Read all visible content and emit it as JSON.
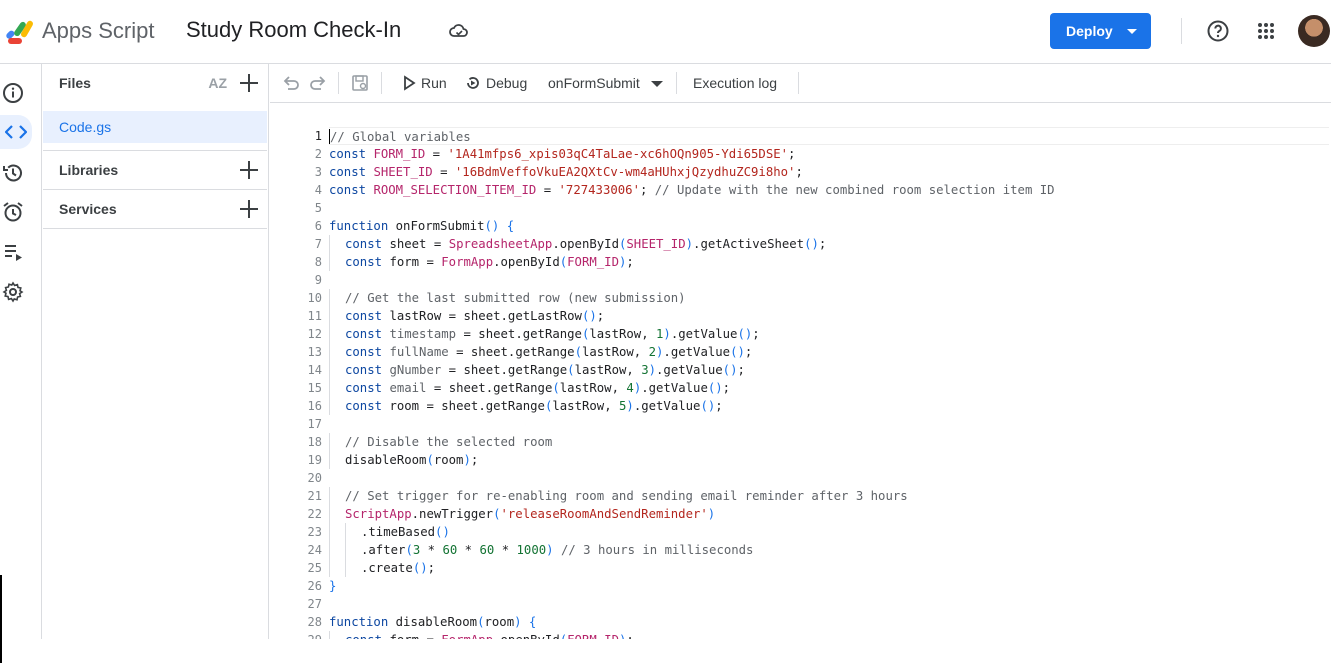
{
  "header": {
    "app_name": "Apps Script",
    "project_title": "Study Room Check-In",
    "deploy_label": "Deploy",
    "icons": [
      "apps-script-logo",
      "cloud-saved-icon",
      "help-icon",
      "apps-grid-icon",
      "avatar"
    ]
  },
  "rail": {
    "icons": [
      "overview-info-icon",
      "editor-code-icon",
      "executions-history-icon",
      "triggers-alarm-icon",
      "executions-list-icon",
      "settings-gear-icon"
    ],
    "active": "editor-code-icon"
  },
  "files_panel": {
    "files_label": "Files",
    "sort_label": "AZ",
    "files": [
      "Code.gs"
    ],
    "libraries_label": "Libraries",
    "services_label": "Services"
  },
  "toolbar": {
    "run_label": "Run",
    "debug_label": "Debug",
    "function_select": "onFormSubmit",
    "execution_log_label": "Execution log"
  },
  "editor": {
    "current_line": 1,
    "lines": [
      {
        "n": "1",
        "text": "// Global variables"
      },
      {
        "n": "2",
        "text": "const FORM_ID = '1A41mfps6_xpis03qC4TaLae-xc6hOQn905-Ydi65DSE';"
      },
      {
        "n": "3",
        "text": "const SHEET_ID = '16BdmVeffoVkuEA2QXtCv-wm4aHUhxjQzydhuZC9i8ho';"
      },
      {
        "n": "4",
        "text": "const ROOM_SELECTION_ITEM_ID = '727433006'; // Update with the new combined room selection item ID"
      },
      {
        "n": "5",
        "text": ""
      },
      {
        "n": "6",
        "text": "function onFormSubmit() {"
      },
      {
        "n": "7",
        "text": "  const sheet = SpreadsheetApp.openById(SHEET_ID).getActiveSheet();"
      },
      {
        "n": "8",
        "text": "  const form = FormApp.openById(FORM_ID);"
      },
      {
        "n": "9",
        "text": ""
      },
      {
        "n": "10",
        "text": "  // Get the last submitted row (new submission)"
      },
      {
        "n": "11",
        "text": "  const lastRow = sheet.getLastRow();"
      },
      {
        "n": "12",
        "text": "  const timestamp = sheet.getRange(lastRow, 1).getValue();"
      },
      {
        "n": "13",
        "text": "  const fullName = sheet.getRange(lastRow, 2).getValue();"
      },
      {
        "n": "14",
        "text": "  const gNumber = sheet.getRange(lastRow, 3).getValue();"
      },
      {
        "n": "15",
        "text": "  const email = sheet.getRange(lastRow, 4).getValue();"
      },
      {
        "n": "16",
        "text": "  const room = sheet.getRange(lastRow, 5).getValue();"
      },
      {
        "n": "17",
        "text": ""
      },
      {
        "n": "18",
        "text": "  // Disable the selected room"
      },
      {
        "n": "19",
        "text": "  disableRoom(room);"
      },
      {
        "n": "20",
        "text": ""
      },
      {
        "n": "21",
        "text": "  // Set trigger for re-enabling room and sending email reminder after 3 hours"
      },
      {
        "n": "22",
        "text": "  ScriptApp.newTrigger('releaseRoomAndSendReminder')"
      },
      {
        "n": "23",
        "text": "    .timeBased()"
      },
      {
        "n": "24",
        "text": "    .after(3 * 60 * 60 * 1000) // 3 hours in milliseconds"
      },
      {
        "n": "25",
        "text": "    .create();"
      },
      {
        "n": "26",
        "text": "}"
      },
      {
        "n": "27",
        "text": ""
      },
      {
        "n": "28",
        "text": "function disableRoom(room) {"
      },
      {
        "n": "29",
        "text": "  const form = FormApp.openById(FORM_ID);"
      }
    ]
  },
  "colors": {
    "accent": "#1a73e8",
    "comment": "#5f6368",
    "keyword": "#0d47a1",
    "identifier": "#b5256b",
    "string": "#b3261e",
    "number": "#137333"
  }
}
